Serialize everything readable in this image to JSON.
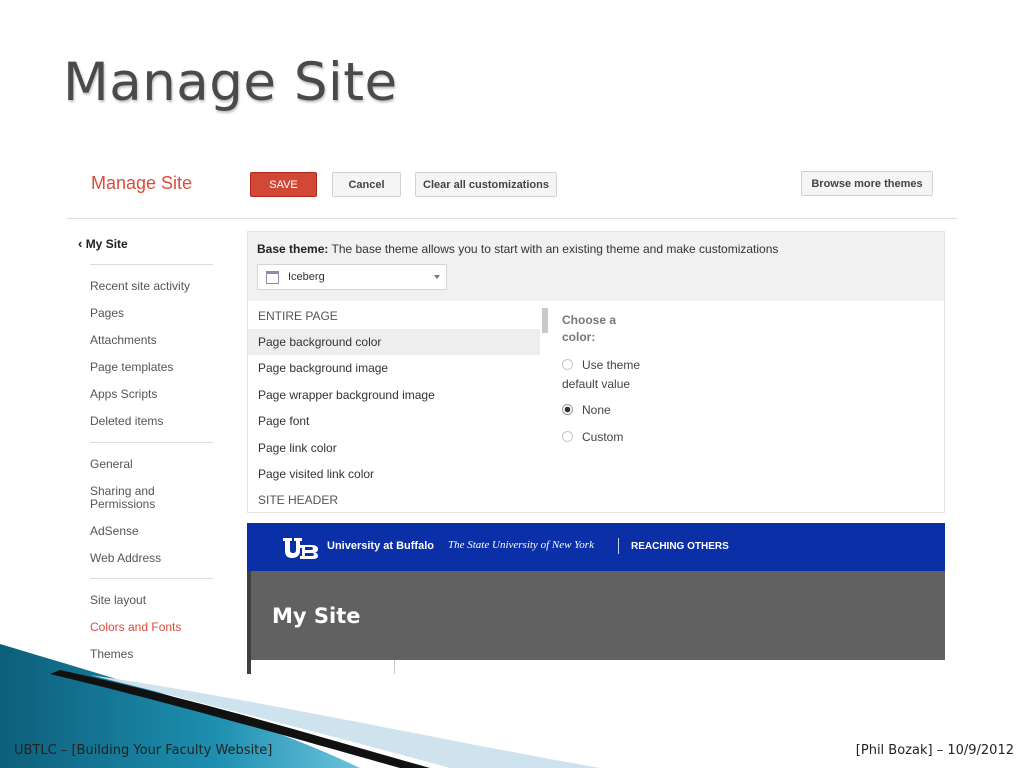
{
  "slide": {
    "title": "Manage Site",
    "footer_left": "UBTLC –  [Building Your Faculty Website]",
    "footer_right": "[Phil Bozak] – 10/9/2012"
  },
  "toolbar": {
    "heading": "Manage Site",
    "save_label": "SAVE",
    "cancel_label": "Cancel",
    "clear_label": "Clear all customizations",
    "browse_label": "Browse more themes"
  },
  "sidebar": {
    "back_label": "My Site",
    "items": [
      {
        "label": "Recent site activity"
      },
      {
        "label": "Pages"
      },
      {
        "label": "Attachments"
      },
      {
        "label": "Page templates"
      },
      {
        "label": "Apps Scripts"
      },
      {
        "label": "Deleted items"
      },
      {
        "label": "General"
      },
      {
        "label": "Sharing and Permissions"
      },
      {
        "label": "AdSense"
      },
      {
        "label": "Web Address"
      },
      {
        "label": "Site layout"
      },
      {
        "label": "Colors and Fonts",
        "active": true
      },
      {
        "label": "Themes"
      }
    ]
  },
  "theme": {
    "base_label": "Base theme:",
    "base_desc": "The base theme allows you to start with an existing theme and make customizations",
    "selected": "Iceberg"
  },
  "options": {
    "section_entire": "ENTIRE PAGE",
    "items": [
      {
        "label": "Page background color",
        "selected": true
      },
      {
        "label": "Page background image"
      },
      {
        "label": "Page wrapper background image"
      },
      {
        "label": "Page font"
      },
      {
        "label": "Page link color"
      },
      {
        "label": "Page visited link color"
      }
    ],
    "section_header": "SITE HEADER"
  },
  "color_chooser": {
    "title": "Choose a color:",
    "opt_theme_line1": "Use theme",
    "opt_theme_line2": "default value",
    "opt_none": "None",
    "opt_custom": "Custom",
    "selected": "None"
  },
  "preview": {
    "org_name": "University at Buffalo",
    "org_sub": "The State University of New York",
    "tagline": "REACHING OTHERS",
    "site_title": "My Site",
    "header_color": "#0a2fa6"
  }
}
